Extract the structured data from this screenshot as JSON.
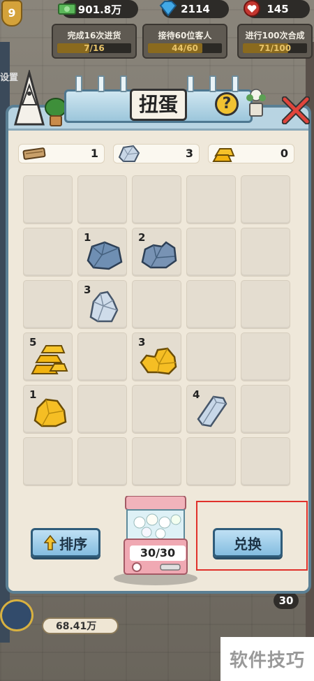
{
  "top_bar": {
    "level": "9",
    "money": "901.8万",
    "gems": "2114",
    "hearts": "145"
  },
  "quests": [
    {
      "title": "完成16次进货",
      "progress": "7/16",
      "fraction": 0.4375
    },
    {
      "title": "接待60位客人",
      "progress": "44/60",
      "fraction": 0.733
    },
    {
      "title": "进行100次合成",
      "progress": "71/100",
      "fraction": 0.71
    }
  ],
  "side_label": "设置",
  "dialog": {
    "title": "扭蛋",
    "help_label": "?",
    "counters": [
      {
        "icon": "wood-plank-icon",
        "value": "1"
      },
      {
        "icon": "silver-ore-icon",
        "value": "3"
      },
      {
        "icon": "gold-ingot-icon",
        "value": "0"
      }
    ],
    "grid": [
      [
        {
          "item": "",
          "count": ""
        },
        {
          "item": "",
          "count": ""
        },
        {
          "item": "",
          "count": ""
        },
        {
          "item": "",
          "count": ""
        },
        {
          "item": "",
          "count": ""
        }
      ],
      [
        {
          "item": "",
          "count": ""
        },
        {
          "item": "stone-ore-icon",
          "count": "1"
        },
        {
          "item": "stone-chunk-icon",
          "count": "2"
        },
        {
          "item": "",
          "count": ""
        },
        {
          "item": "",
          "count": ""
        }
      ],
      [
        {
          "item": "",
          "count": ""
        },
        {
          "item": "silver-crystal-icon",
          "count": "3"
        },
        {
          "item": "",
          "count": ""
        },
        {
          "item": "",
          "count": ""
        },
        {
          "item": "",
          "count": ""
        }
      ],
      [
        {
          "item": "gold-ingot-stack-icon",
          "count": "5"
        },
        {
          "item": "",
          "count": ""
        },
        {
          "item": "gold-nugget-cluster-icon",
          "count": "3"
        },
        {
          "item": "",
          "count": ""
        },
        {
          "item": "",
          "count": ""
        }
      ],
      [
        {
          "item": "gold-nugget-icon",
          "count": "1"
        },
        {
          "item": "",
          "count": ""
        },
        {
          "item": "",
          "count": ""
        },
        {
          "item": "silver-bar-icon",
          "count": "4"
        },
        {
          "item": "",
          "count": ""
        }
      ],
      [
        {
          "item": "",
          "count": ""
        },
        {
          "item": "",
          "count": ""
        },
        {
          "item": "",
          "count": ""
        },
        {
          "item": "",
          "count": ""
        },
        {
          "item": "",
          "count": ""
        }
      ]
    ],
    "sort_label": "排序",
    "exchange_label": "兑换",
    "capsule_count": "30/30"
  },
  "bottom_bar": {
    "money": "68.41万",
    "badge": "30"
  },
  "watermark": "软件技巧",
  "colors": {
    "accent": "#84bde0",
    "highlight": "#e0302a",
    "gold": "#f1c231"
  }
}
